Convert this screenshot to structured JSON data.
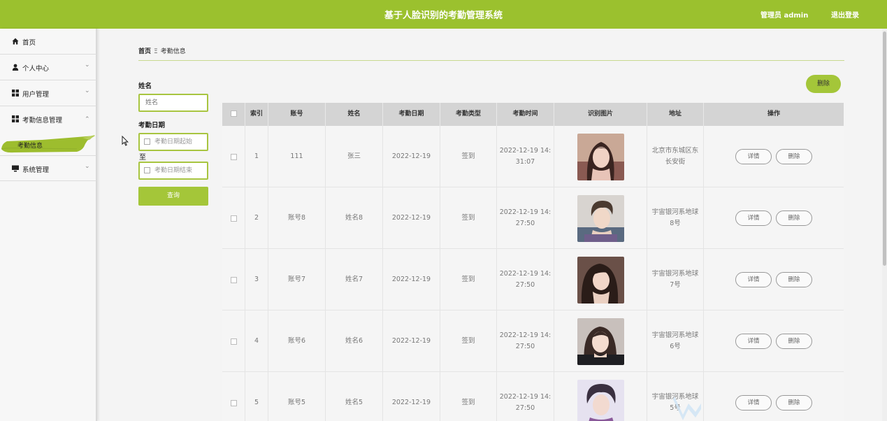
{
  "header": {
    "title": "基于人脸识别的考勤管理系统",
    "admin": "管理员 admin",
    "logout": "退出登录"
  },
  "sidebar": {
    "items": [
      {
        "label": "首页",
        "icon": "home-icon"
      },
      {
        "label": "个人中心",
        "icon": "user-icon"
      },
      {
        "label": "用户管理",
        "icon": "grid-icon"
      },
      {
        "label": "考勤信息管理",
        "icon": "grid-icon"
      },
      {
        "label": "系统管理",
        "icon": "monitor-icon"
      }
    ],
    "submenu_active": "考勤信息"
  },
  "breadcrumb": {
    "home": "首页",
    "sep": "Ξ",
    "current": "考勤信息"
  },
  "search": {
    "name_label": "姓名",
    "name_placeholder": "姓名",
    "date_label": "考勤日期",
    "date_start_placeholder": "考勤日期起始",
    "to": "至",
    "date_end_placeholder": "考勤日期结束",
    "button": "查询"
  },
  "toolbar": {
    "delete": "删除"
  },
  "table": {
    "headers": [
      "索引",
      "账号",
      "姓名",
      "考勤日期",
      "考勤类型",
      "考勤时间",
      "识别图片",
      "地址",
      "操作"
    ],
    "rows": [
      {
        "index": "1",
        "account": "111",
        "name": "张三",
        "date": "2022-12-19",
        "type": "签到",
        "time1": "2022-12-19 14:",
        "time2": "31:07",
        "addr1": "北京市东城区东",
        "addr2": "长安街"
      },
      {
        "index": "2",
        "account": "账号8",
        "name": "姓名8",
        "date": "2022-12-19",
        "type": "签到",
        "time1": "2022-12-19 14:",
        "time2": "27:50",
        "addr1": "宇宙银河系地球",
        "addr2": "8号"
      },
      {
        "index": "3",
        "account": "账号7",
        "name": "姓名7",
        "date": "2022-12-19",
        "type": "签到",
        "time1": "2022-12-19 14:",
        "time2": "27:50",
        "addr1": "宇宙银河系地球",
        "addr2": "7号"
      },
      {
        "index": "4",
        "account": "账号6",
        "name": "姓名6",
        "date": "2022-12-19",
        "type": "签到",
        "time1": "2022-12-19 14:",
        "time2": "27:50",
        "addr1": "宇宙银河系地球",
        "addr2": "6号"
      },
      {
        "index": "5",
        "account": "账号5",
        "name": "姓名5",
        "date": "2022-12-19",
        "type": "签到",
        "time1": "2022-12-19 14:",
        "time2": "27:50",
        "addr1": "宇宙银河系地球",
        "addr2": "5号"
      }
    ],
    "detail_label": "详情",
    "delete_label": "删除"
  },
  "colors": {
    "accent": "#9bc12e",
    "button": "#a4c639",
    "border": "#a8c540"
  }
}
